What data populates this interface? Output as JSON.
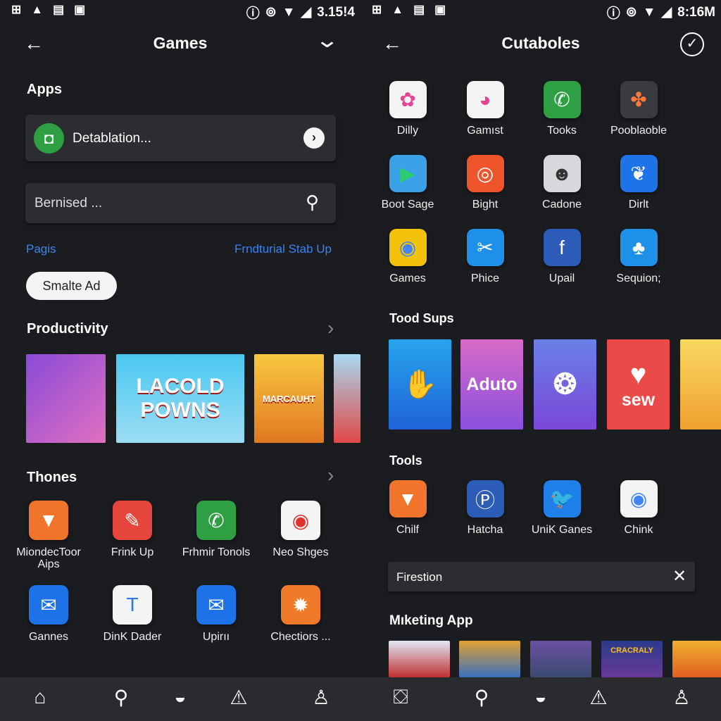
{
  "colors": {
    "background": "#1b1c20",
    "card": "#2c2d31",
    "link": "#3b82f6",
    "nav": "#2a2b2f"
  },
  "left": {
    "status": {
      "icons": [
        "sim-icon",
        "alert-icon",
        "storage-icon",
        "screen-icon"
      ],
      "right_icons": [
        "info-icon",
        "hotspot-icon",
        "wifi-icon",
        "signal-icon"
      ],
      "time": "3.15!4"
    },
    "header": {
      "title": "Games",
      "back_icon": "arrow-left-icon",
      "menu_icon": "chevron-down-icon"
    },
    "apps_heading": "Apps",
    "app_card": {
      "label": "Detablation...",
      "icon": "green-app-icon"
    },
    "search": {
      "placeholder": "Bernised ..."
    },
    "links": {
      "left": "Pagis",
      "right": "Frndturial Stab Up"
    },
    "pill_button": "Smalte Ad",
    "productivity": {
      "heading": "Productivity",
      "banners": [
        {
          "text": ""
        },
        {
          "text": "LACOLD POWNS"
        },
        {
          "text": "MARCAUHT"
        },
        {
          "text": ""
        }
      ]
    },
    "thones": {
      "heading": "Thones",
      "apps": [
        {
          "label": "MiondecToor Aips",
          "bg": "#f0742a",
          "glyph": "▼"
        },
        {
          "label": "Frink Up",
          "bg": "#e5453a",
          "glyph": "✎"
        },
        {
          "label": "Frhmir Tonols",
          "bg": "#2ea043",
          "glyph": "✆"
        },
        {
          "label": "Neo Shges",
          "bg": "#f4f4f4",
          "glyph": "◉",
          "fg": "#e03030"
        },
        {
          "label": "Gannes",
          "bg": "#1e73e8",
          "glyph": "✉"
        },
        {
          "label": "DinK Dader",
          "bg": "#f4f4f4",
          "glyph": "T",
          "fg": "#2a7ae2"
        },
        {
          "label": "Upirıı",
          "bg": "#1e73e8",
          "glyph": "✉"
        },
        {
          "label": "Chectiors ...",
          "bg": "#f07a28",
          "glyph": "✹"
        }
      ]
    },
    "nav": [
      "home-icon",
      "search-icon",
      "basket-icon",
      "alert-board-icon",
      "profile-icon"
    ]
  },
  "right": {
    "status": {
      "time": "8:16M"
    },
    "header": {
      "title": "Cutaboles",
      "back_icon": "arrow-left-icon",
      "confirm_icon": "check-circle-icon"
    },
    "apps": [
      {
        "label": "Dilly",
        "bg": "#f4f4f4",
        "glyph": "✿",
        "fg": "#e84393"
      },
      {
        "label": "Gamıst",
        "bg": "#f4f4f4",
        "glyph": "◕",
        "fg": "#e84393"
      },
      {
        "label": "Tooks",
        "bg": "#2ea043",
        "glyph": "✆"
      },
      {
        "label": "Pooblaoble",
        "bg": "#3a3b40",
        "glyph": "✤",
        "fg": "#ff7a3a"
      },
      {
        "label": "Boot Sage",
        "bg": "#3aa0e8",
        "glyph": "▶",
        "fg": "#2ecc71"
      },
      {
        "label": "Bight",
        "bg": "#f0542a",
        "glyph": "◎"
      },
      {
        "label": "Cadone",
        "bg": "#d8d8dc",
        "glyph": "☻",
        "fg": "#333"
      },
      {
        "label": "Dirlt",
        "bg": "#1e73e8",
        "glyph": "❦"
      },
      {
        "label": "Games",
        "bg": "#f4c20d",
        "glyph": "◉",
        "fg": "#4285f4"
      },
      {
        "label": "Phice",
        "bg": "#1e90e8",
        "glyph": "✂"
      },
      {
        "label": "Upail",
        "bg": "#2d5cb8",
        "glyph": "f"
      },
      {
        "label": "Sequion;",
        "bg": "#1e90e8",
        "glyph": "♣"
      }
    ],
    "tood_sups": {
      "heading": "Tood Sups",
      "tiles": [
        {
          "text": "",
          "glyph": "✋",
          "bg": "linear-gradient(#27a4ec,#1f63d8)"
        },
        {
          "text": "Aduto",
          "glyph": "",
          "bg": "linear-gradient(#d86ac8,#8a50dc)"
        },
        {
          "text": "",
          "glyph": "❂",
          "bg": "linear-gradient(#6a80e8,#7a48d8)"
        },
        {
          "text": "sew",
          "glyph": "♥",
          "bg": "#ea4a48"
        },
        {
          "text": "",
          "glyph": "",
          "bg": "linear-gradient(#f8d860,#f0a030)"
        }
      ]
    },
    "tools": {
      "heading": "Tools",
      "apps": [
        {
          "label": "Chilf",
          "bg": "#f0742a",
          "glyph": "▼"
        },
        {
          "label": "Hatcha",
          "bg": "#2d5cb8",
          "glyph": "Ⓟ"
        },
        {
          "label": "UniK Ganes",
          "bg": "#1e80e8",
          "glyph": "🐦"
        },
        {
          "label": "Chink",
          "bg": "#f4f4f4",
          "glyph": "◉",
          "fg": "#4285f4"
        }
      ]
    },
    "filter": {
      "value": "Firestion",
      "clear_icon": "close-icon"
    },
    "marketing": {
      "heading": "Mıketing App",
      "thumbs": [
        {
          "text": "",
          "bg": "linear-gradient(#dfe8f4,#c03030)"
        },
        {
          "text": "",
          "bg": "linear-gradient(#e0a030,#3a70c0)"
        },
        {
          "text": "",
          "bg": "linear-gradient(#6a50a0,#3a4a70)"
        },
        {
          "text": "CRACRALY",
          "bg": "linear-gradient(#2a3a8a,#6a3a9a)"
        },
        {
          "text": "",
          "bg": "linear-gradient(#f0b030,#e06020)"
        }
      ]
    },
    "nav": [
      "store-icon",
      "search-icon",
      "basket-icon",
      "alert-board-icon",
      "profile-icon"
    ]
  }
}
